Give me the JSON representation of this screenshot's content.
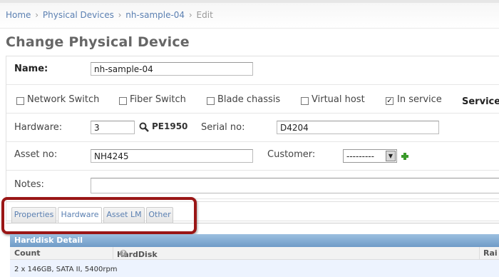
{
  "breadcrumbs": {
    "home": "Home",
    "section": "Physical Devices",
    "object": "nh-sample-04",
    "current": "Edit",
    "separator": "›"
  },
  "page_title": "Change Physical Device",
  "form": {
    "name": {
      "label": "Name:",
      "value": "nh-sample-04"
    },
    "checkboxes": [
      {
        "label": "Network Switch",
        "checked": false
      },
      {
        "label": "Fiber Switch",
        "checked": false
      },
      {
        "label": "Blade chassis",
        "checked": false
      },
      {
        "label": "Virtual host",
        "checked": false
      },
      {
        "label": "In service",
        "checked": true
      }
    ],
    "service_label": "Service",
    "hardware": {
      "label": "Hardware:",
      "value": "3",
      "lookup_text": "PE1950"
    },
    "serial": {
      "label": "Serial no:",
      "value": "D4204"
    },
    "asset": {
      "label": "Asset no:",
      "value": "NH4245"
    },
    "customer": {
      "label": "Customer:",
      "selected": "---------"
    },
    "notes": {
      "label": "Notes:",
      "value": ""
    }
  },
  "tabs": [
    {
      "label": "Properties",
      "active": false
    },
    {
      "label": "Hardware",
      "active": true
    },
    {
      "label": "Asset LM",
      "active": false
    },
    {
      "label": "Other",
      "active": false
    }
  ],
  "harddisk": {
    "title": "Harddisk Detail",
    "columns": [
      "Count",
      "HardDisk",
      "Rai"
    ],
    "rows": [
      {
        "count": "2 x 146GB, SATA II, 5400rpm"
      }
    ]
  },
  "colors": {
    "link": "#5b80b2",
    "highlight": "#9a1616",
    "module_header": "#7aa5cf",
    "add_icon": "#3a9a2a"
  },
  "icons": {
    "lookup": "search-icon",
    "add": "plus-icon",
    "help": "help-icon"
  }
}
